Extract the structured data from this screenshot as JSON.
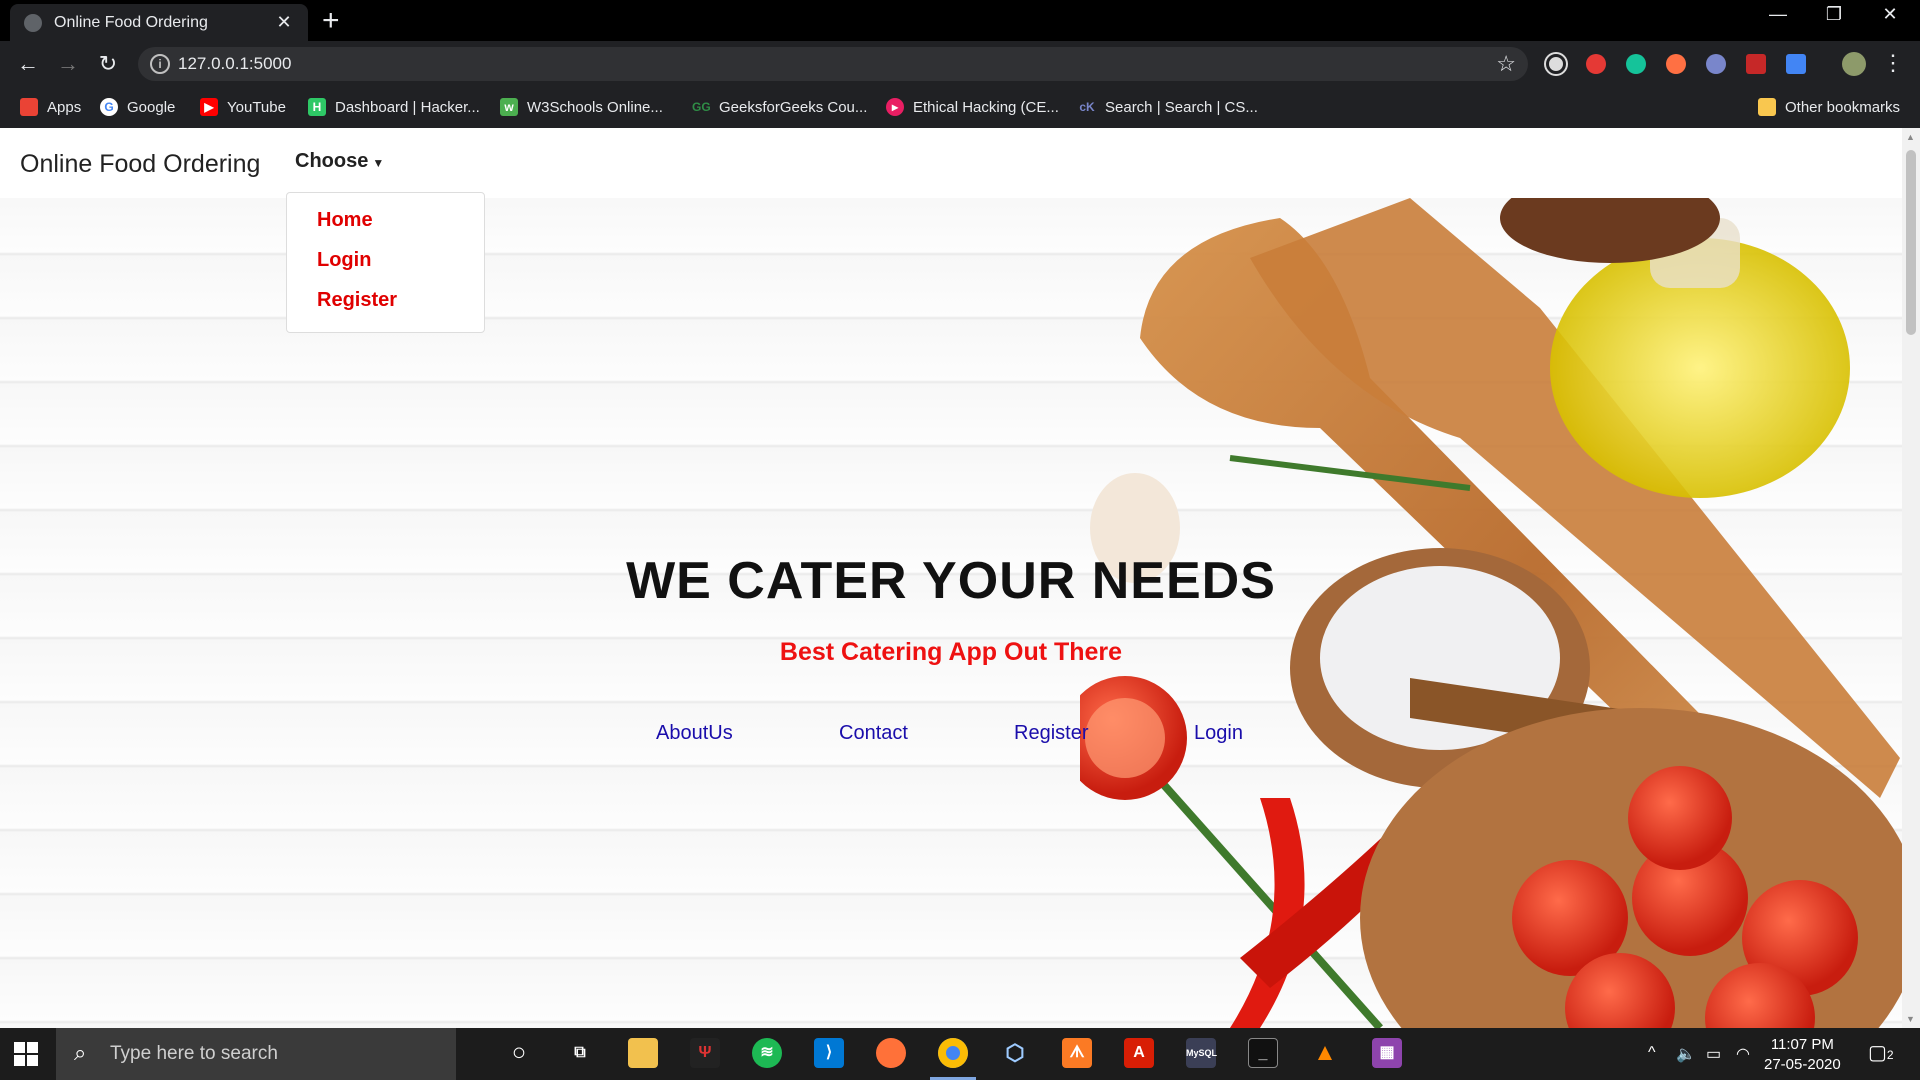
{
  "browser": {
    "tab_title": "Online Food Ordering",
    "url": "127.0.0.1:5000",
    "bookmarks": [
      {
        "label": "Apps",
        "icon": "apps-grid-icon",
        "color": "#ea4335"
      },
      {
        "label": "Google",
        "icon": "google-icon",
        "color": "#4285f4"
      },
      {
        "label": "YouTube",
        "icon": "youtube-icon",
        "color": "#ff0000"
      },
      {
        "label": "Dashboard | Hacker...",
        "icon": "hackerrank-icon",
        "color": "#2ec866"
      },
      {
        "label": "W3Schools Online...",
        "icon": "w3schools-icon",
        "color": "#4caf50"
      },
      {
        "label": "GeeksforGeeks Cou...",
        "icon": "geeksforgeeks-icon",
        "color": "#2f8d46"
      },
      {
        "label": "Ethical Hacking (CE...",
        "icon": "ethical-hacking-icon",
        "color": "#e91e63"
      },
      {
        "label": "Search | Search | CS...",
        "icon": "cs-search-icon",
        "color": "#5c6bc0"
      }
    ],
    "other_bookmarks": "Other bookmarks"
  },
  "navbar": {
    "brand": "Online Food Ordering",
    "dropdown_label": "Choose",
    "dropdown_items": [
      "Home",
      "Login",
      "Register"
    ]
  },
  "hero": {
    "title": "WE CATER YOUR NEEDS",
    "subtitle": "Best Catering App Out There",
    "links": [
      "AboutUs",
      "Contact",
      "Register",
      "Login"
    ]
  },
  "taskbar": {
    "search_placeholder": "Type here to search",
    "time": "11:07 PM",
    "date": "27-05-2020",
    "notification_count": "2"
  },
  "colors": {
    "accent_red": "#e00000",
    "link_blue": "#1a0dab",
    "chrome_dark": "#202124"
  }
}
